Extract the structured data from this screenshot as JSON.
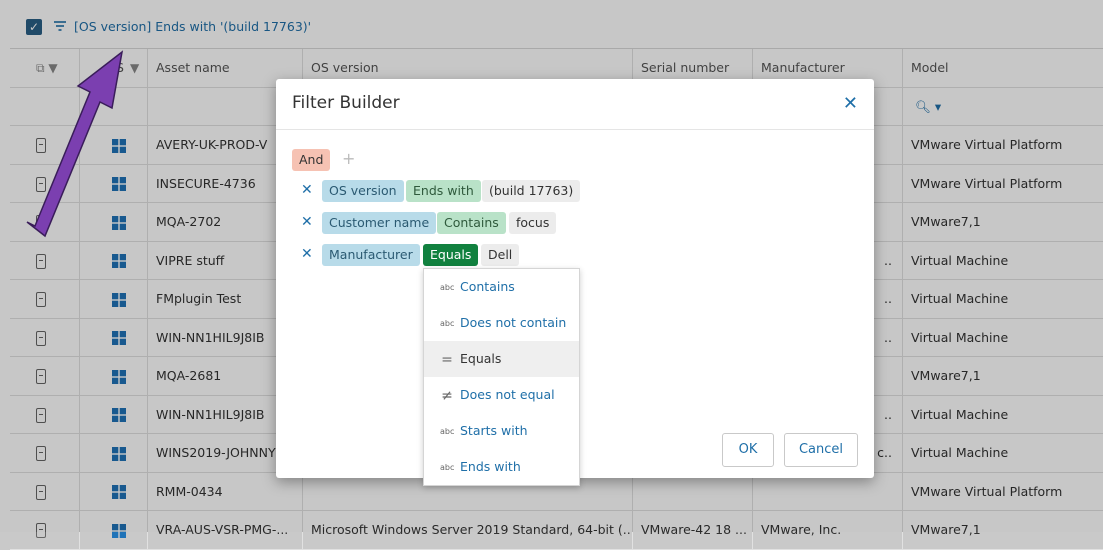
{
  "filter_summary": {
    "text": "[OS version] Ends with '(build 17763)'"
  },
  "grid": {
    "headers": [
      "",
      "",
      "Asset name",
      "OS version",
      "Serial number",
      "Manufacturer",
      "Model"
    ],
    "header_col2_fragment": "S",
    "rows": [
      {
        "name": "AVERY-UK-PROD-V",
        "os": "",
        "serial": "",
        "mfr": "",
        "model": "VMware Virtual Platform"
      },
      {
        "name": "INSECURE-4736",
        "os": "",
        "serial": "",
        "mfr": "",
        "model": "VMware Virtual Platform"
      },
      {
        "name": "MQA-2702",
        "os": "",
        "serial": "",
        "mfr": "",
        "model": "VMware7,1"
      },
      {
        "name": "VIPRE stuff",
        "os": "",
        "serial": "",
        "mfr": "..",
        "model": "Virtual Machine"
      },
      {
        "name": "FMplugin Test",
        "os": "",
        "serial": "",
        "mfr": "..",
        "model": "Virtual Machine"
      },
      {
        "name": "WIN-NN1HIL9J8IB",
        "os": "",
        "serial": "",
        "mfr": "..",
        "model": "Virtual Machine"
      },
      {
        "name": "MQA-2681",
        "os": "",
        "serial": "",
        "mfr": "",
        "model": "VMware7,1"
      },
      {
        "name": "WIN-NN1HIL9J8IB",
        "os": "",
        "serial": "",
        "mfr": "..",
        "model": "Virtual Machine"
      },
      {
        "name": "WINS2019-JOHNNY",
        "os": "",
        "serial": "",
        "mfr": "c..",
        "model": "Virtual Machine"
      },
      {
        "name": "RMM-0434",
        "os": "",
        "serial": "",
        "mfr": "",
        "model": "VMware Virtual Platform"
      },
      {
        "name": "VRA-AUS-VSR-PMG-...",
        "os": "Microsoft Windows Server 2019 Standard, 64-bit (...",
        "serial": "VMware-42 18 ...",
        "mfr": "VMware, Inc.",
        "model": "VMware7,1"
      }
    ]
  },
  "dialog": {
    "title": "Filter Builder",
    "group_op": "And",
    "conditions": [
      {
        "field": "OS version",
        "op": "Ends with",
        "value": "(build 17763)"
      },
      {
        "field": "Customer name",
        "op": "Contains",
        "value": "focus"
      },
      {
        "field": "Manufacturer",
        "op": "Equals",
        "value": "Dell"
      }
    ],
    "ok_label": "OK",
    "cancel_label": "Cancel"
  },
  "operator_menu": {
    "items": [
      {
        "label": "Contains",
        "icon": "abc"
      },
      {
        "label": "Does not contain",
        "icon": "abc"
      },
      {
        "label": "Equals",
        "icon": "="
      },
      {
        "label": "Does not equal",
        "icon": "≠"
      },
      {
        "label": "Starts with",
        "icon": "abc"
      },
      {
        "label": "Ends with",
        "icon": "abc"
      }
    ],
    "selected": "Equals"
  },
  "colors": {
    "accent": "#1f6fa8",
    "and_tag": "#f6c2b3",
    "field_tag": "#b8dbe9",
    "op_tag": "#b9e2c8",
    "op_selected": "#11813f",
    "arrow": "#7b3fb0"
  }
}
